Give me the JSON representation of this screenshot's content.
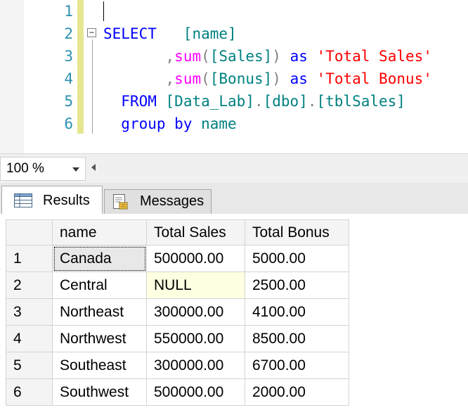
{
  "editor": {
    "line_numbers": [
      "1",
      "2",
      "3",
      "4",
      "5",
      "6"
    ],
    "line2": {
      "select": "SELECT",
      "col": "[name]"
    },
    "line3": {
      "comma": ",",
      "fn": "sum",
      "open": "(",
      "col": "[Sales]",
      "close": ")",
      "as": "as",
      "alias": "'Total Sales'"
    },
    "line4": {
      "comma": ",",
      "fn": "sum",
      "open": "(",
      "col": "[Bonus]",
      "close": ")",
      "as": "as",
      "alias": "'Total Bonus'"
    },
    "line5": {
      "from": "FROM",
      "db": "[Data_Lab]",
      "dot1": ".",
      "schema": "[dbo]",
      "dot2": ".",
      "table": "[tblSales]"
    },
    "line6": {
      "group_by": "group by",
      "col": "name"
    },
    "fold_glyph": "−"
  },
  "zoom": {
    "value": "100 %"
  },
  "tabs": [
    {
      "label": "Results",
      "icon": "grid-icon"
    },
    {
      "label": "Messages",
      "icon": "messages-icon"
    }
  ],
  "results": {
    "columns": [
      "name",
      "Total Sales",
      "Total Bonus"
    ],
    "rows": [
      {
        "num": "1",
        "name": "Canada",
        "sales": "500000.00",
        "bonus": "5000.00"
      },
      {
        "num": "2",
        "name": "Central",
        "sales": "NULL",
        "bonus": "2500.00"
      },
      {
        "num": "3",
        "name": "Northeast",
        "sales": "300000.00",
        "bonus": "4100.00"
      },
      {
        "num": "4",
        "name": "Northwest",
        "sales": "550000.00",
        "bonus": "8500.00"
      },
      {
        "num": "5",
        "name": "Southeast",
        "sales": "300000.00",
        "bonus": "6700.00"
      },
      {
        "num": "6",
        "name": "Southwest",
        "sales": "500000.00",
        "bonus": "2000.00"
      }
    ]
  },
  "colors": {
    "keyword": "#0000ff",
    "function": "#ff00ff",
    "string": "#ff0000",
    "identifier": "#008080",
    "line_number": "#2b91af",
    "change_bar": "#e6e690"
  }
}
